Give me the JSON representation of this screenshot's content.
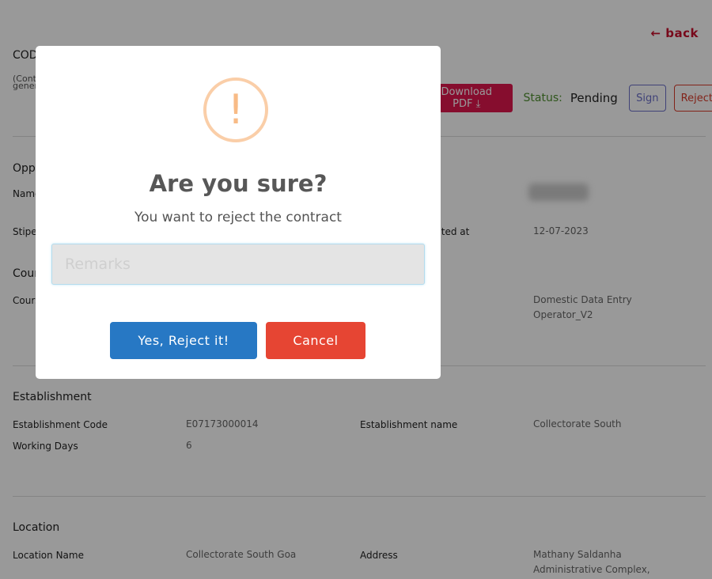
{
  "header": {
    "back_label": "← back",
    "code_title": "CODE",
    "code_subtitle": "(Contract generated)",
    "download_pdf_label": "Download PDF ⤓",
    "status_label": "Status:",
    "status_value": "Pending",
    "sign_label": "Sign",
    "reject_label": "Reject"
  },
  "opportunity": {
    "title": "Opportunity",
    "name_label": "Name",
    "stipend_label": "Stipend",
    "created_at_label": "Created at",
    "created_at_value": "12-07-2023"
  },
  "course": {
    "title": "Course",
    "course_label": "Course",
    "course_value": "Domestic Data Entry Operator_V2"
  },
  "establishment": {
    "title": "Establishment",
    "code_label": "Establishment Code",
    "code_value": "E07173000014",
    "name_label": "Establishment name",
    "name_value": "Collectorate South",
    "working_days_label": "Working Days",
    "working_days_value": "6"
  },
  "location": {
    "title": "Location",
    "name_label": "Location Name",
    "name_value": "Collectorate South Goa",
    "address_label": "Address",
    "address_value": "Mathany Saldanha Administrative Complex,"
  },
  "modal": {
    "icon": "!",
    "title": "Are you sure?",
    "text": "You want to reject the contract",
    "remarks_placeholder": "Remarks",
    "remarks_value": "",
    "confirm_label": "Yes, Reject it!",
    "cancel_label": "Cancel"
  }
}
